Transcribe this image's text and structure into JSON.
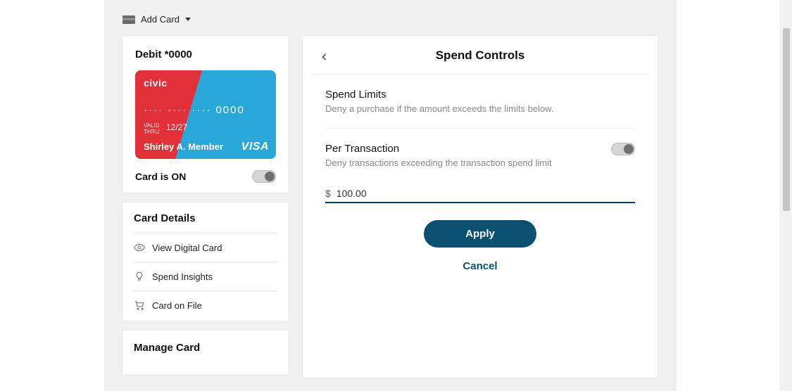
{
  "header": {
    "add_card_label": "Add Card"
  },
  "card_panel": {
    "title": "Debit *0000",
    "brand": "civic",
    "number_masked": "···· ···· ···· 0000",
    "valid_label": "VALID\nTHRU",
    "valid_thru": "12/27",
    "holder_name": "Shirley A. Member",
    "network": "VISA",
    "on_label": "Card is ON",
    "on_state": true
  },
  "details": {
    "title": "Card Details",
    "items": [
      {
        "label": "View Digital Card",
        "icon": "eye-icon"
      },
      {
        "label": "Spend Insights",
        "icon": "bulb-icon"
      },
      {
        "label": "Card on File",
        "icon": "cart-icon"
      }
    ]
  },
  "manage": {
    "title": "Manage Card"
  },
  "spend_controls": {
    "title": "Spend Controls",
    "limits_title": "Spend Limits",
    "limits_sub": "Deny a purchase if the amount exceeds the limits below.",
    "per_tx_title": "Per Transaction",
    "per_tx_sub": "Deny transactions exceeding the transaction spend limit",
    "per_tx_enabled": true,
    "currency_prefix": "$",
    "amount_value": "100.00",
    "apply_label": "Apply",
    "cancel_label": "Cancel"
  }
}
